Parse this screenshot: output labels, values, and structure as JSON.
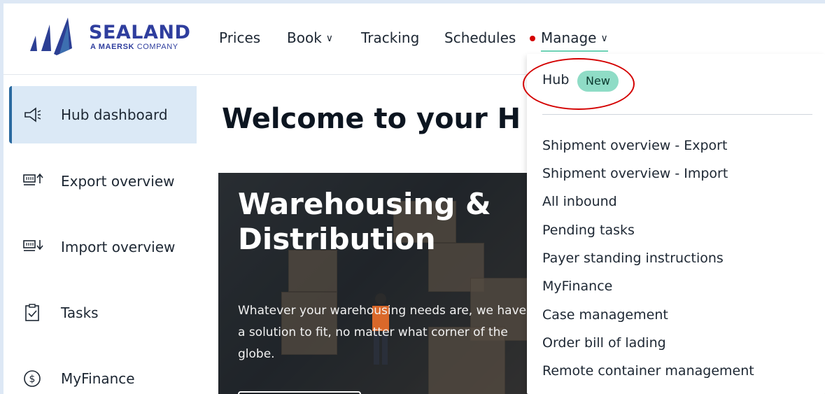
{
  "logo": {
    "word": "SEALAND",
    "sub_bold": "A MAERSK",
    "sub_rest": " COMPANY"
  },
  "nav": [
    {
      "label": "Prices"
    },
    {
      "label": "Book"
    },
    {
      "label": "Tracking"
    },
    {
      "label": "Schedules"
    },
    {
      "label": "Manage"
    }
  ],
  "sidebar": [
    {
      "label": "Hub dashboard",
      "icon": "megaphone-icon"
    },
    {
      "label": "Export overview",
      "icon": "export-icon"
    },
    {
      "label": "Import overview",
      "icon": "import-icon"
    },
    {
      "label": "Tasks",
      "icon": "clipboard-check-icon"
    },
    {
      "label": "MyFinance",
      "icon": "dollar-circle-icon"
    }
  ],
  "main": {
    "welcome": "Welcome to your H",
    "hero_title": "Warehousing & Distribution",
    "hero_text": "Whatever your warehousing needs are, we have a solution to fit, no matter what corner of the globe."
  },
  "dropdown": {
    "hub_label": "Hub",
    "hub_badge": "New",
    "items": [
      "Shipment overview - Export",
      "Shipment overview - Import",
      "All inbound",
      "Pending tasks",
      "Payer standing instructions",
      "MyFinance",
      "Case management",
      "Order bill of lading",
      "Remote container management"
    ]
  },
  "colors": {
    "brand": "#2f3e9e",
    "accent": "#6fd3b6",
    "badge": "#8fdcc6",
    "notification": "#d40000",
    "sidebar_active": "#dbe9f6"
  }
}
